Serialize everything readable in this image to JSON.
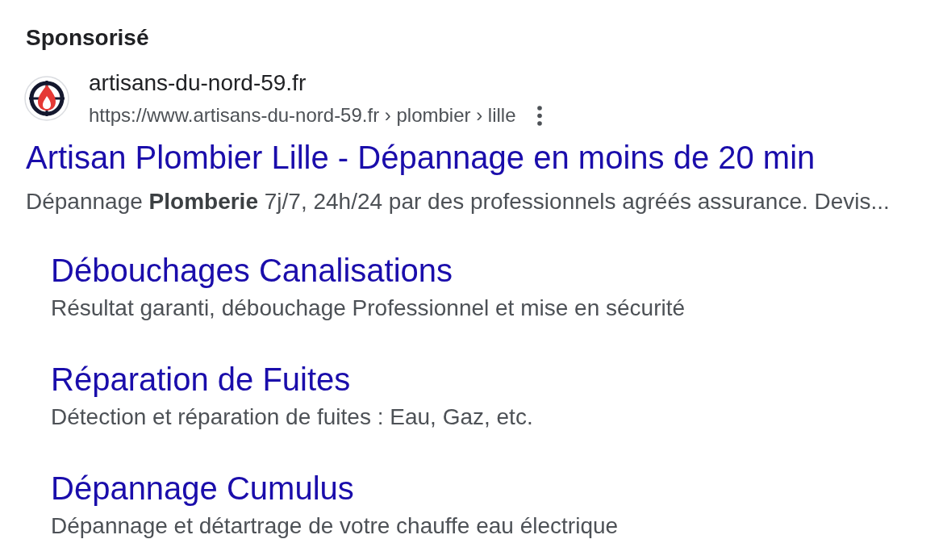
{
  "ad_label": "Sponsorisé",
  "advertiser": {
    "name": "artisans-du-nord-59.fr",
    "url": "https://www.artisans-du-nord-59.fr › plombier › lille"
  },
  "headline": "Artisan Plombier Lille - Dépannage en moins de 20 min",
  "description": "Dépannage **Plomberie** 7j/7, 24h/24 par des professionnels agréés assurance. Devis...",
  "sitelinks": [
    {
      "title": "Débouchages Canalisations",
      "description": "Résultat garanti, débouchage Professionnel et mise en sécurité"
    },
    {
      "title": "Réparation de Fuites",
      "description": "Détection et réparation de fuites : Eau, Gaz, etc."
    },
    {
      "title": "Dépannage Cumulus",
      "description": "Dépannage et détartrage de votre chauffe eau électrique"
    }
  ]
}
